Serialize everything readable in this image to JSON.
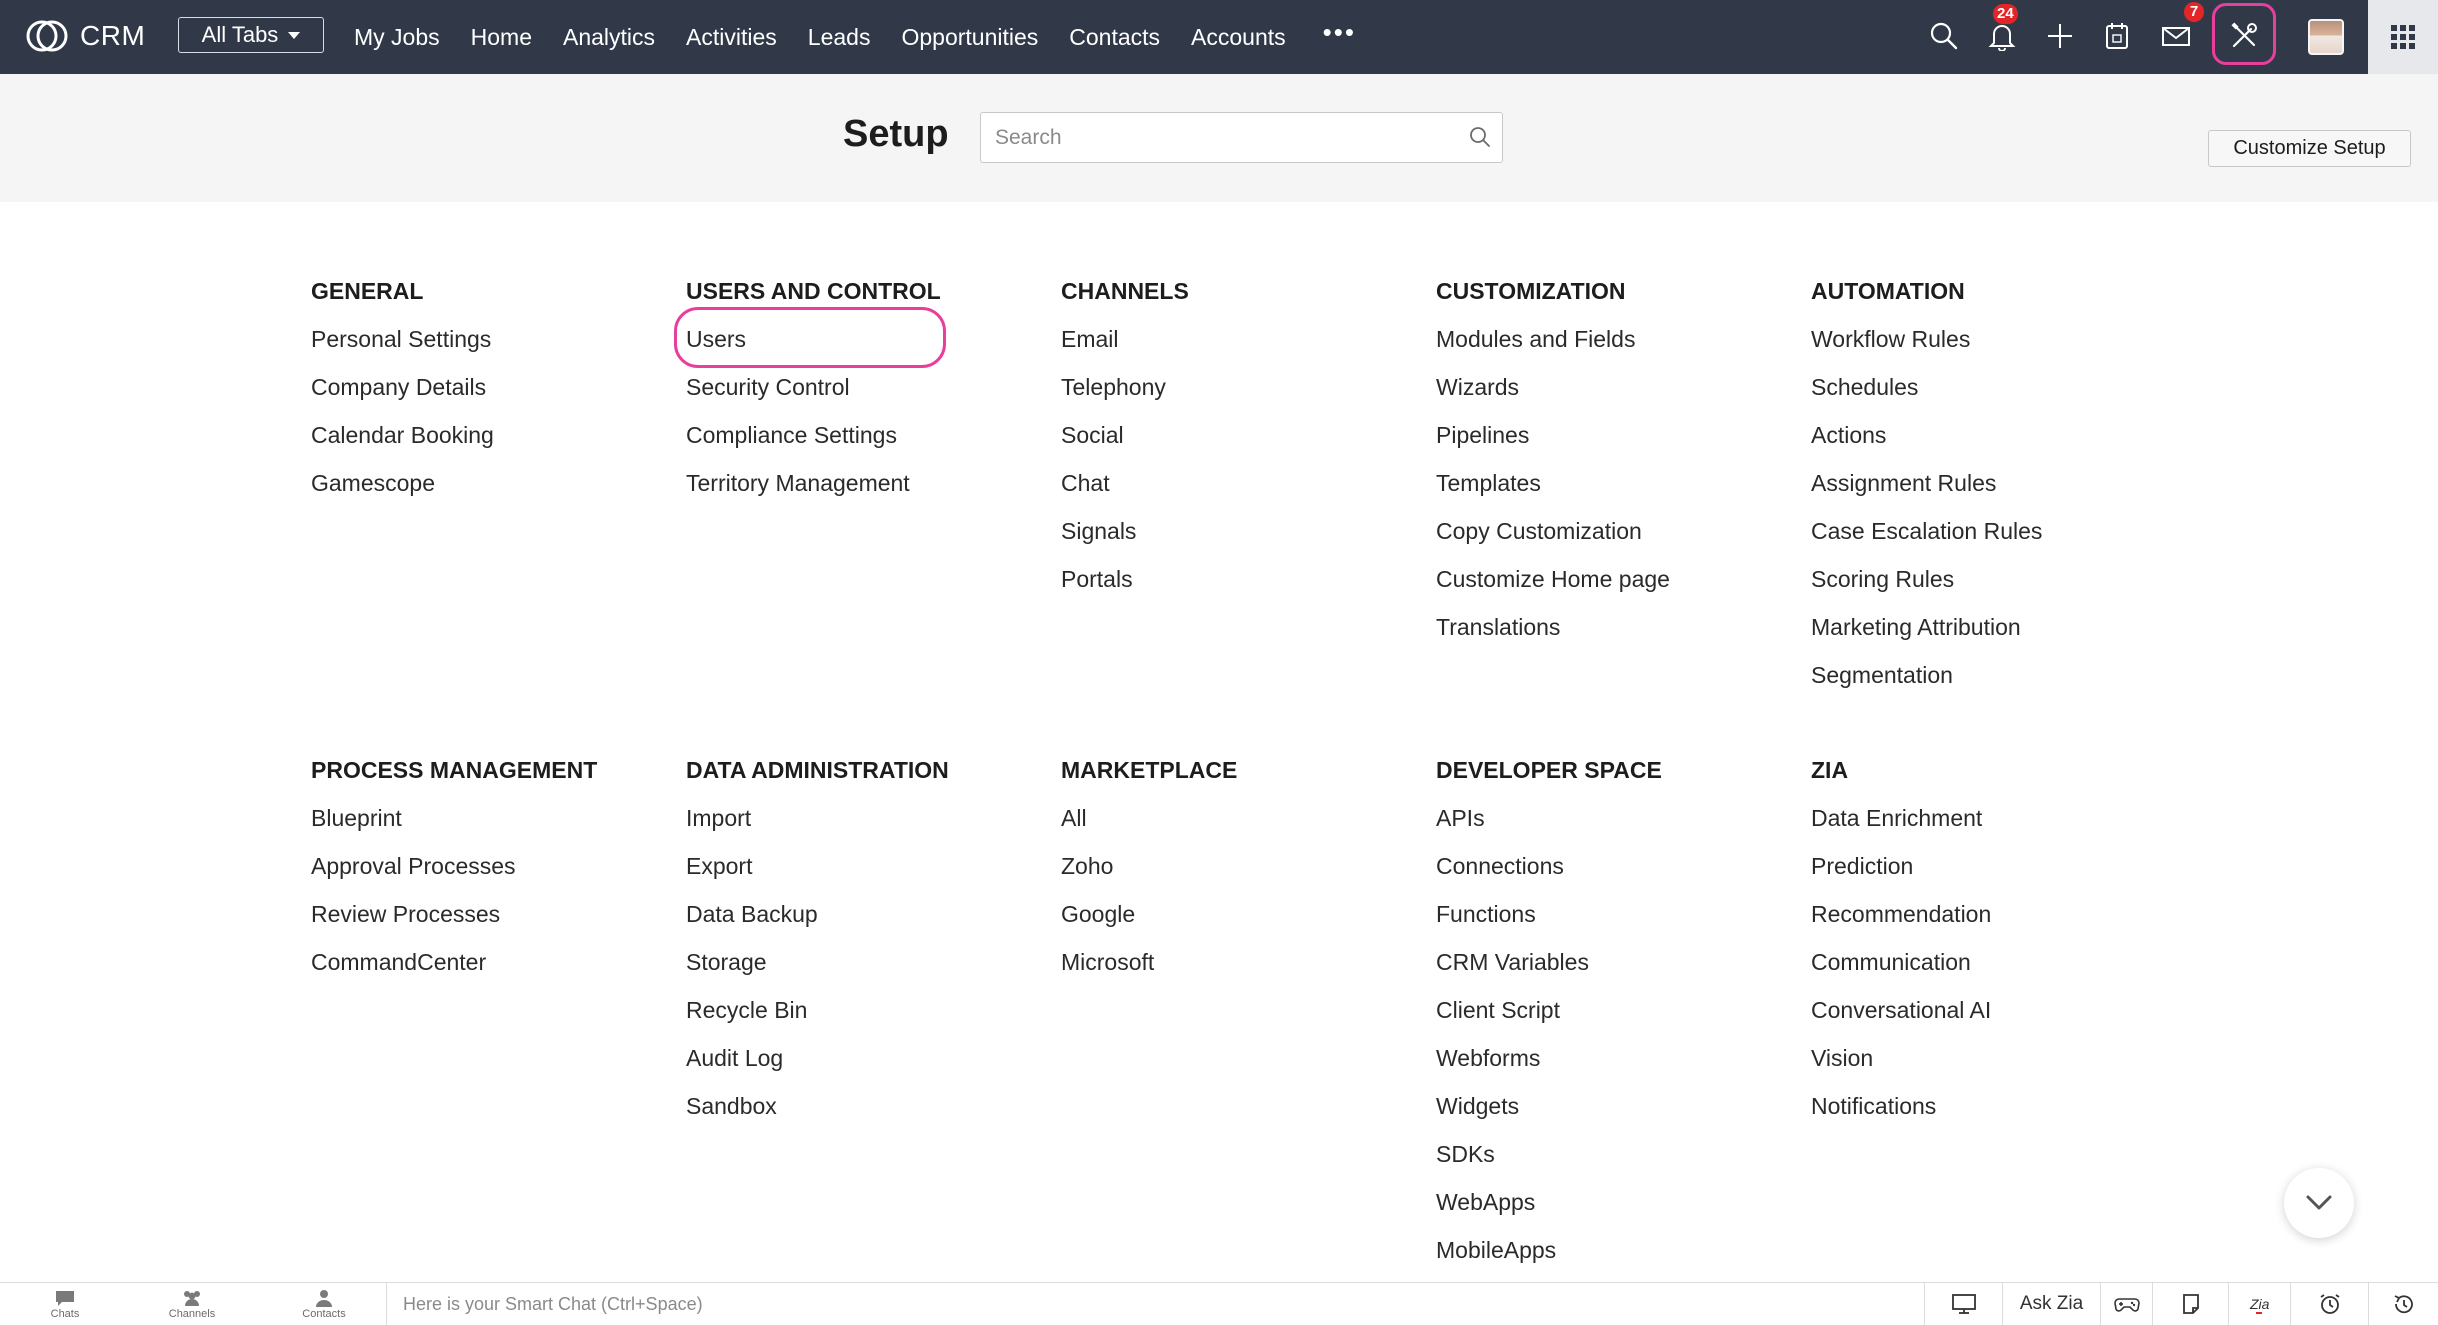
{
  "topbar": {
    "logo_text": "CRM",
    "all_tabs_label": "All Tabs",
    "nav_links": [
      "My Jobs",
      "Home",
      "Analytics",
      "Activities",
      "Leads",
      "Opportunities",
      "Contacts",
      "Accounts"
    ],
    "more_label": "•••",
    "notifications_count": "24",
    "mail_count": "7",
    "highlight_color": "#e83e9c",
    "background_color": "#313949"
  },
  "setup": {
    "title": "Setup",
    "search_placeholder": "Search",
    "customize_button": "Customize Setup"
  },
  "sections": [
    {
      "title": "GENERAL",
      "items": [
        "Personal Settings",
        "Company Details",
        "Calendar Booking",
        "Gamescope"
      ]
    },
    {
      "title": "USERS AND CONTROL",
      "items": [
        "Users",
        "Security Control",
        "Compliance Settings",
        "Territory Management"
      ]
    },
    {
      "title": "CHANNELS",
      "items": [
        "Email",
        "Telephony",
        "Social",
        "Chat",
        "Signals",
        "Portals"
      ]
    },
    {
      "title": "CUSTOMIZATION",
      "items": [
        "Modules and Fields",
        "Wizards",
        "Pipelines",
        "Templates",
        "Copy Customization",
        "Customize Home page",
        "Translations"
      ]
    },
    {
      "title": "AUTOMATION",
      "items": [
        "Workflow Rules",
        "Schedules",
        "Actions",
        "Assignment Rules",
        "Case Escalation Rules",
        "Scoring Rules",
        "Marketing Attribution",
        "Segmentation"
      ]
    },
    {
      "title": "PROCESS MANAGEMENT",
      "items": [
        "Blueprint",
        "Approval Processes",
        "Review Processes",
        "CommandCenter"
      ]
    },
    {
      "title": "DATA ADMINISTRATION",
      "items": [
        "Import",
        "Export",
        "Data Backup",
        "Storage",
        "Recycle Bin",
        "Audit Log",
        "Sandbox"
      ]
    },
    {
      "title": "MARKETPLACE",
      "items": [
        "All",
        "Zoho",
        "Google",
        "Microsoft"
      ]
    },
    {
      "title": "DEVELOPER SPACE",
      "items": [
        "APIs",
        "Connections",
        "Functions",
        "CRM Variables",
        "Client Script",
        "Webforms",
        "Widgets",
        "SDKs",
        "WebApps",
        "MobileApps"
      ]
    },
    {
      "title": "ZIA",
      "items": [
        "Data Enrichment",
        "Prediction",
        "Recommendation",
        "Communication",
        "Conversational AI",
        "Vision",
        "Notifications"
      ]
    }
  ],
  "bottombar": {
    "chats_label": "Chats",
    "channels_label": "Channels",
    "contacts_label": "Contacts",
    "smartchat_placeholder": "Here is your Smart Chat (Ctrl+Space)",
    "ask_zia_label": "Ask Zia"
  }
}
